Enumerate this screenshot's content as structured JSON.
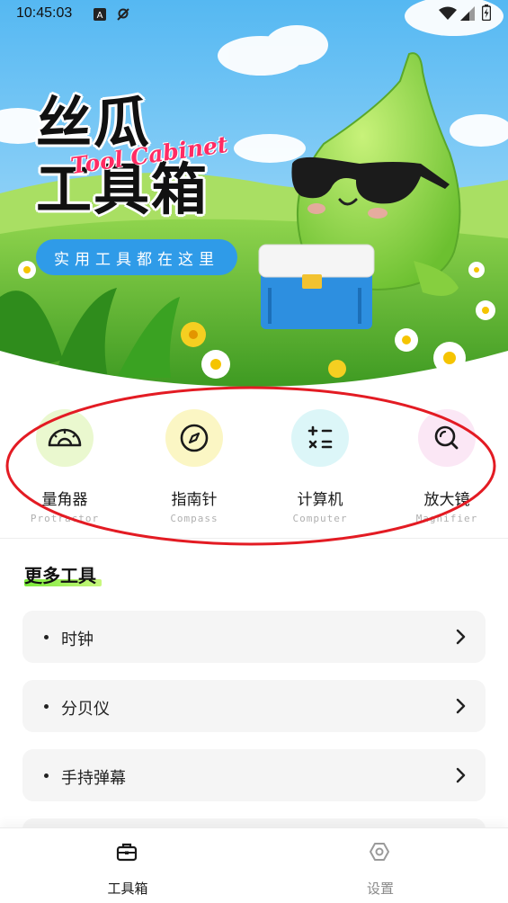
{
  "status_bar": {
    "time": "10:45:03",
    "icons": [
      "notification-a-icon",
      "location-off-icon",
      "wifi-icon",
      "signal-icon",
      "battery-icon"
    ]
  },
  "hero": {
    "title_line1": "丝瓜",
    "title_line2": "工具箱",
    "title_en": "Tool Cabinet",
    "slogan": "实用工具都在这里",
    "accent_color": "#ff2b63",
    "slogan_color": "#2f9be8"
  },
  "quick_tools": [
    {
      "name": "量角器",
      "en": "Protractor",
      "icon": "protractor-icon",
      "bg": "#eaf8cf"
    },
    {
      "name": "指南针",
      "en": "Compass",
      "icon": "compass-icon",
      "bg": "#fbf6c4"
    },
    {
      "name": "计算机",
      "en": "Computer",
      "icon": "calculator-icon",
      "bg": "#dcf6f8"
    },
    {
      "name": "放大镜",
      "en": "Magnifier",
      "icon": "magnifier-icon",
      "bg": "#fbe7f5"
    }
  ],
  "more_tools": {
    "title": "更多工具",
    "items": [
      {
        "label": "时钟"
      },
      {
        "label": "分贝仪"
      },
      {
        "label": "手持弹幕"
      }
    ]
  },
  "bottom_nav": [
    {
      "label": "工具箱",
      "icon": "toolbox-icon",
      "active": true
    },
    {
      "label": "设置",
      "icon": "settings-icon",
      "active": false
    }
  ],
  "colors": {
    "annotation_ellipse": "#e31b23",
    "underline_green": "#7bea3a"
  }
}
